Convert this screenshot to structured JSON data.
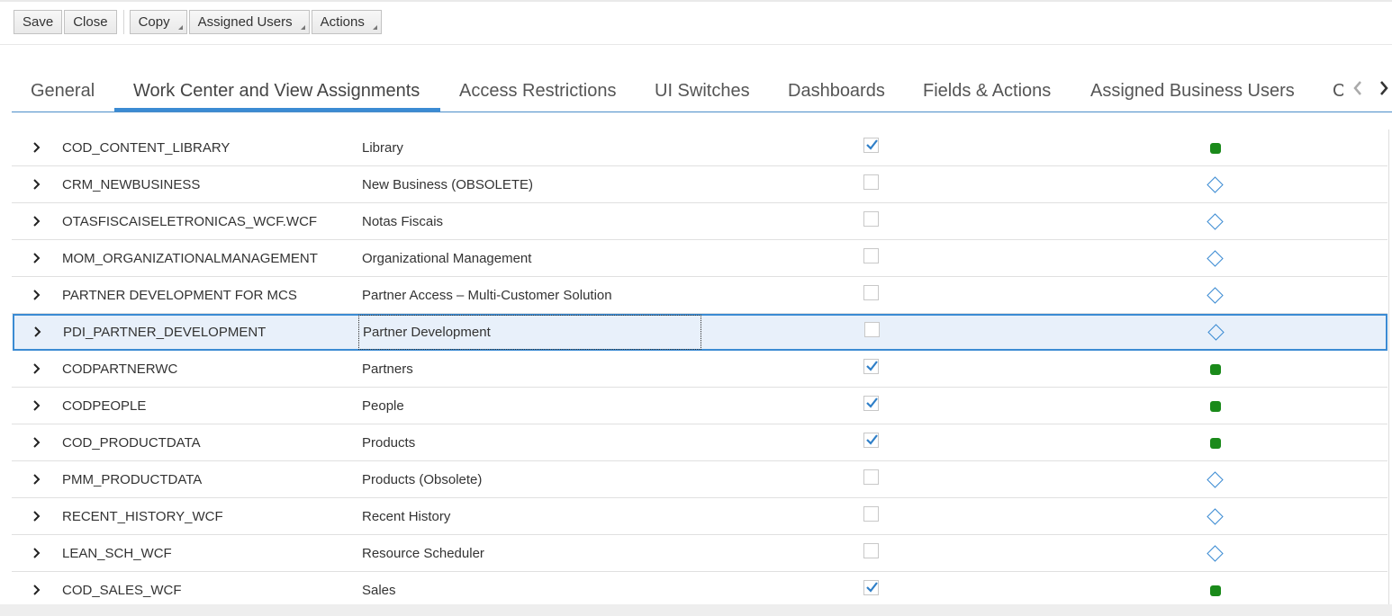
{
  "toolbar": {
    "save_label": "Save",
    "close_label": "Close",
    "copy_label": "Copy",
    "assigned_users_label": "Assigned Users",
    "actions_label": "Actions"
  },
  "tabs": [
    {
      "label": "General"
    },
    {
      "label": "Work Center and View Assignments",
      "active": true
    },
    {
      "label": "Access Restrictions"
    },
    {
      "label": "UI Switches"
    },
    {
      "label": "Dashboards"
    },
    {
      "label": "Fields & Actions"
    },
    {
      "label": "Assigned Business Users"
    },
    {
      "label": "C"
    }
  ],
  "tab_nav": {
    "prev_icon": "chevron-left-icon",
    "next_icon": "chevron-right-icon"
  },
  "rows": [
    {
      "id": "COD_CONTENT_LIBRARY",
      "desc": "Library",
      "checked": true,
      "status": "assigned"
    },
    {
      "id": "CRM_NEWBUSINESS",
      "desc": "New Business (OBSOLETE)",
      "checked": false,
      "status": "unassigned"
    },
    {
      "id": "OTASFISCAISELETRONICAS_WCF.WCF",
      "desc": "Notas Fiscais",
      "checked": false,
      "status": "unassigned"
    },
    {
      "id": "MOM_ORGANIZATIONALMANAGEMENT",
      "desc": "Organizational Management",
      "checked": false,
      "status": "unassigned"
    },
    {
      "id": "PARTNER DEVELOPMENT FOR MCS",
      "desc": "Partner Access – Multi-Customer Solution",
      "checked": false,
      "status": "unassigned"
    },
    {
      "id": "PDI_PARTNER_DEVELOPMENT",
      "desc": "Partner Development",
      "checked": false,
      "status": "unassigned",
      "selected": true
    },
    {
      "id": "CODPARTNERWC",
      "desc": "Partners",
      "checked": true,
      "status": "assigned"
    },
    {
      "id": "CODPEOPLE",
      "desc": "People",
      "checked": true,
      "status": "assigned"
    },
    {
      "id": "COD_PRODUCTDATA",
      "desc": "Products",
      "checked": true,
      "status": "assigned"
    },
    {
      "id": "PMM_PRODUCTDATA",
      "desc": "Products (Obsolete)",
      "checked": false,
      "status": "unassigned"
    },
    {
      "id": "RECENT_HISTORY_WCF",
      "desc": "Recent History",
      "checked": false,
      "status": "unassigned"
    },
    {
      "id": "LEAN_SCH_WCF",
      "desc": "Resource Scheduler",
      "checked": false,
      "status": "unassigned"
    },
    {
      "id": "COD_SALES_WCF",
      "desc": "Sales",
      "checked": true,
      "status": "assigned"
    }
  ],
  "colors": {
    "accent": "#3b8bd3",
    "assigned": "#1a8a1a",
    "selected_row": "#e8f0fa"
  }
}
